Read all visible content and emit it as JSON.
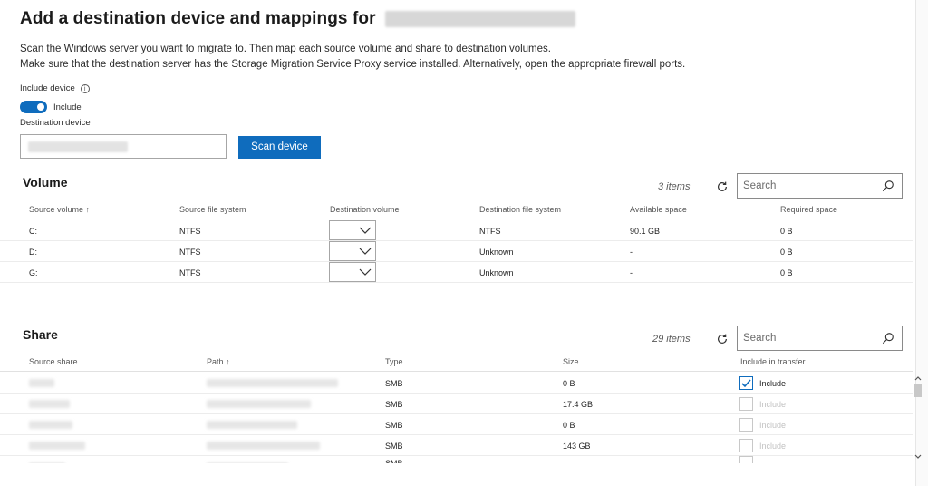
{
  "page": {
    "title": "Add a destination device and mappings for",
    "desc1": "Scan the Windows server you want to migrate to. Then map each source volume and share to destination volumes.",
    "desc2": "Make sure that the destination server has the Storage Migration Service Proxy service installed. Alternatively, open the appropriate firewall ports.",
    "include_device_label": "Include device",
    "toggle_label": "Include",
    "destination_device_label": "Destination device",
    "scan_button": "Scan device",
    "accent_color": "#0f6cbd"
  },
  "volume": {
    "title": "Volume",
    "count": "3 items",
    "search_placeholder": "Search",
    "columns": [
      "Source volume ↑",
      "Source file system",
      "Destination volume",
      "Destination file system",
      "Available space",
      "Required space"
    ],
    "rows": [
      {
        "source": "C:",
        "fs": "NTFS",
        "dest_fs": "NTFS",
        "available": "90.1 GB",
        "required": "0 B"
      },
      {
        "source": "D:",
        "fs": "NTFS",
        "dest_fs": "Unknown",
        "available": "-",
        "required": "0 B"
      },
      {
        "source": "G:",
        "fs": "NTFS",
        "dest_fs": "Unknown",
        "available": "-",
        "required": "0 B"
      }
    ]
  },
  "share": {
    "title": "Share",
    "count": "29 items",
    "search_placeholder": "Search",
    "columns": [
      "Source share",
      "Path ↑",
      "Type",
      "Size",
      "Include in transfer"
    ],
    "rows": [
      {
        "type": "SMB",
        "size": "0 B",
        "include": "Include",
        "checked": true
      },
      {
        "type": "SMB",
        "size": "17.4 GB",
        "include": "Include",
        "checked": false
      },
      {
        "type": "SMB",
        "size": "0 B",
        "include": "Include",
        "checked": false
      },
      {
        "type": "SMB",
        "size": "143 GB",
        "include": "Include",
        "checked": false
      },
      {
        "type": "SMB",
        "size": "",
        "include": "",
        "checked": false
      }
    ]
  }
}
